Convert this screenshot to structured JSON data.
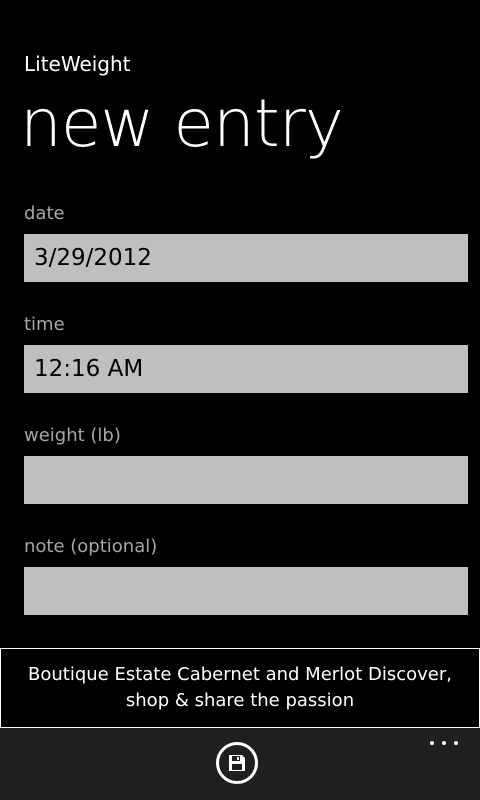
{
  "app": {
    "title": "LiteWeight"
  },
  "page": {
    "title": "new entry"
  },
  "form": {
    "date": {
      "label": "date",
      "value": "3/29/2012"
    },
    "time": {
      "label": "time",
      "value": "12:16 AM"
    },
    "weight": {
      "label": "weight (lb)",
      "value": ""
    },
    "note": {
      "label": "note (optional)",
      "value": ""
    }
  },
  "ad": {
    "text": "Boutique Estate Cabernet and Merlot Discover, shop & share the passion"
  },
  "app_bar": {
    "save_icon": "save-icon",
    "more_icon": "more-icon"
  },
  "colors": {
    "background": "#000000",
    "input_background": "#bfbfbf",
    "label": "#a6a6a6",
    "app_bar": "#1f1f1f"
  }
}
